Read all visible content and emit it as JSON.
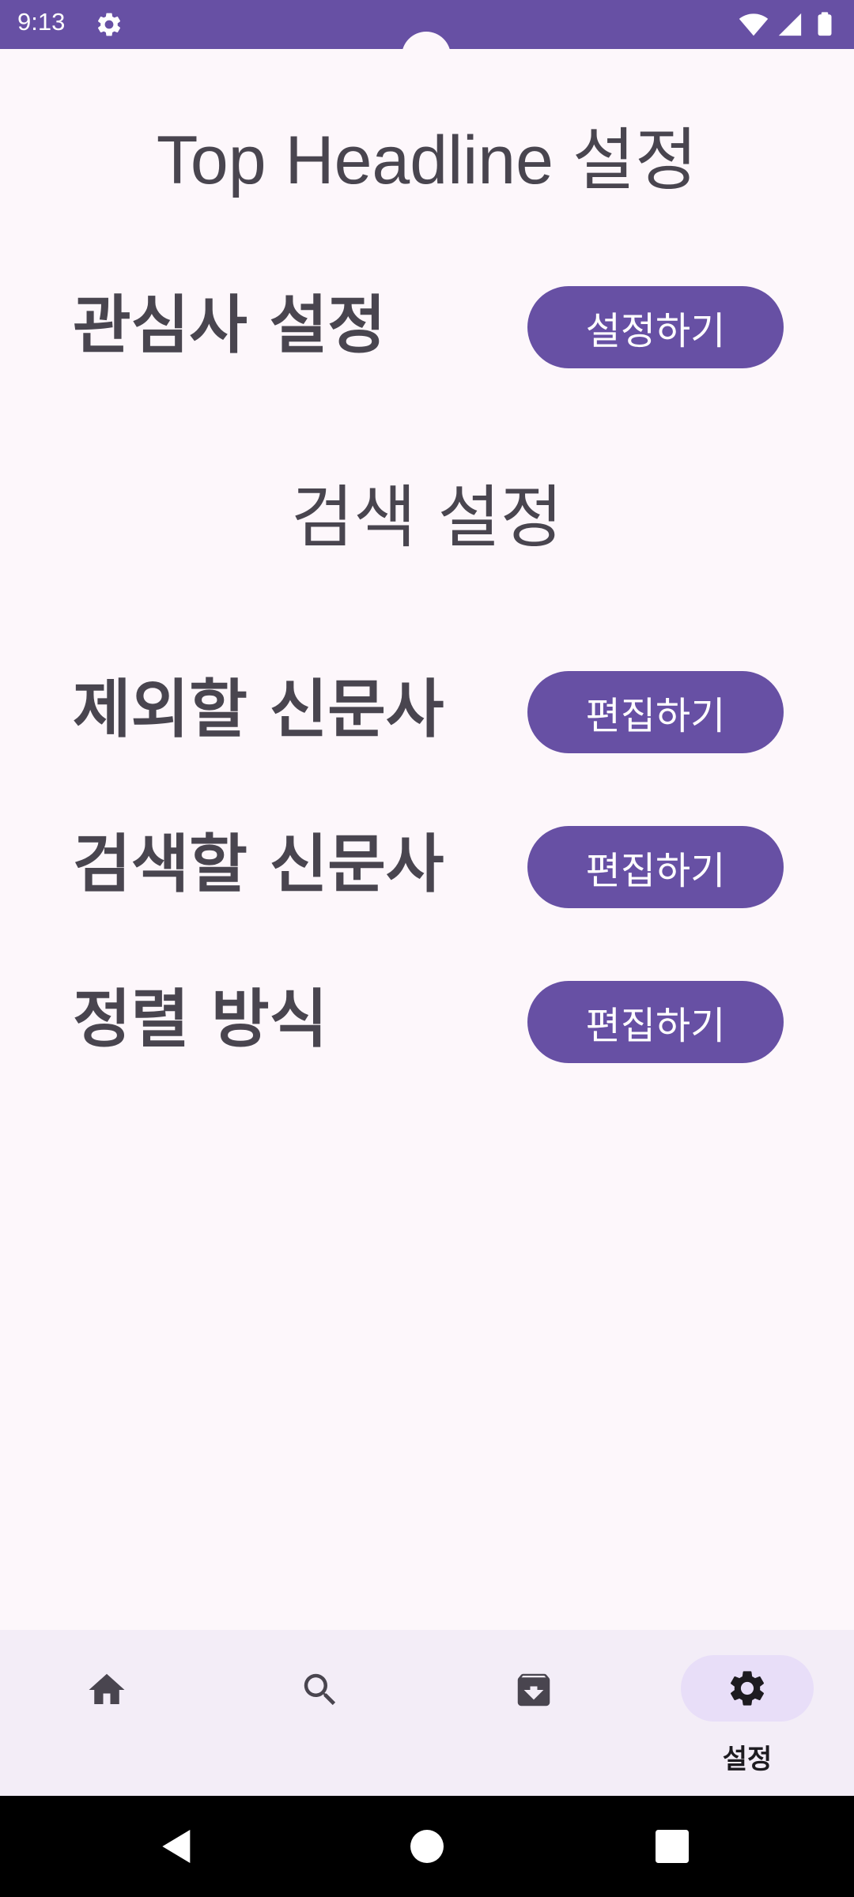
{
  "status_bar": {
    "time": "9:13",
    "background": "#6750a4"
  },
  "page": {
    "title": "Top Headline 설정",
    "section_search_title": "검색 설정"
  },
  "rows": [
    {
      "label": "관심사 설정",
      "button_label": "설정하기"
    },
    {
      "label": "제외할 신문사",
      "button_label": "편집하기"
    },
    {
      "label": "검색할 신문사",
      "button_label": "편집하기"
    },
    {
      "label": "정렬 방식",
      "button_label": "편집하기"
    }
  ],
  "bottom_nav": {
    "items": [
      {
        "icon": "home-icon",
        "label": ""
      },
      {
        "icon": "search-icon",
        "label": ""
      },
      {
        "icon": "archive-icon",
        "label": ""
      },
      {
        "icon": "gear-icon",
        "label": "설정",
        "active": true
      }
    ]
  },
  "colors": {
    "primary": "#6750a4",
    "background": "#fdf7fb",
    "nav_background": "#f3edf7",
    "active_indicator": "#e8def8",
    "text": "#49454f"
  }
}
